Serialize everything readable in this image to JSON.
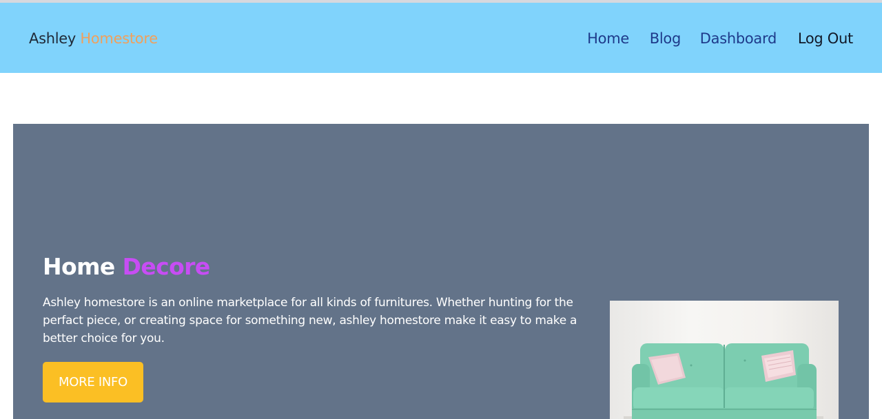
{
  "brand": {
    "name": "Ashley",
    "accent": "Homestore"
  },
  "nav": {
    "home": "Home",
    "blog": "Blog",
    "dashboard": "Dashboard",
    "logout": "Log Out"
  },
  "hero": {
    "title": "Home",
    "title_accent": "Decore",
    "description": "Ashley homestore is an online marketplace for all kinds of furnitures. Whether hunting for the perfact piece, or creating space for something new, ashley homestore make it easy to make a better choice for you.",
    "button_label": "MORE INFO",
    "image_icon": "mint-sofa-photo"
  },
  "colors": {
    "navbar_bg": "#80d3fc",
    "brand_accent": "#f0a05c",
    "hero_bg": "#637389",
    "title_accent": "#c74df4",
    "button_bg": "#fbbf24",
    "sofa": "#7fcfb2"
  }
}
